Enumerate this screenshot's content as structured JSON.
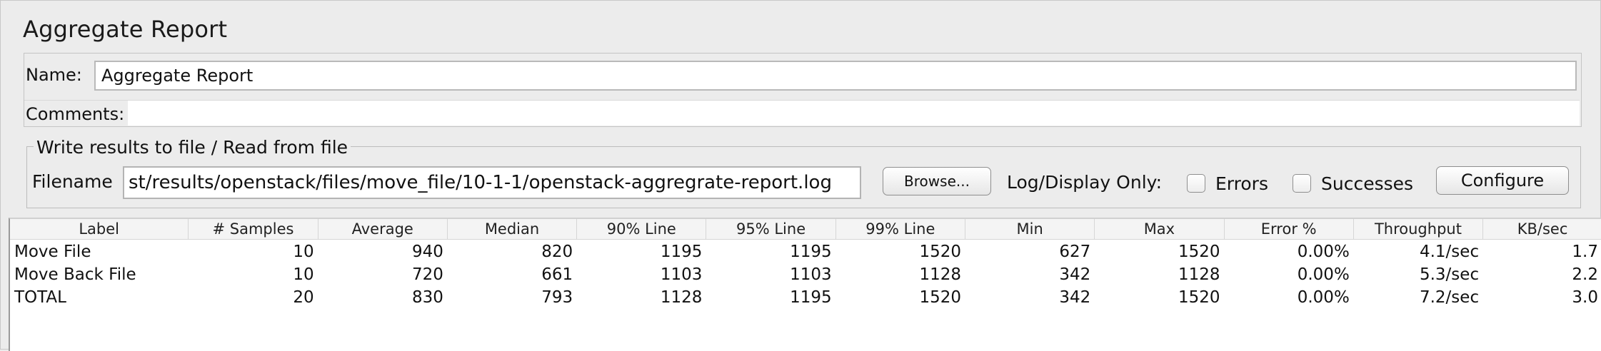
{
  "panel": {
    "title": "Aggregate Report",
    "name_label": "Name:",
    "name_value": "Aggregate Report",
    "comments_label": "Comments:",
    "comments_value": ""
  },
  "file_section": {
    "legend": "Write results to file / Read from file",
    "filename_label": "Filename",
    "filename_value": "st/results/openstack/files/move_file/10-1-1/openstack-aggregrate-report.log",
    "browse_label": "Browse...",
    "log_display_label": "Log/Display Only:",
    "errors_label": "Errors",
    "errors_checked": false,
    "successes_label": "Successes",
    "successes_checked": false,
    "configure_label": "Configure"
  },
  "table": {
    "columns": [
      "Label",
      "# Samples",
      "Average",
      "Median",
      "90% Line",
      "95% Line",
      "99% Line",
      "Min",
      "Max",
      "Error %",
      "Throughput",
      "KB/sec"
    ],
    "rows": [
      [
        "Move File",
        "10",
        "940",
        "820",
        "1195",
        "1195",
        "1520",
        "627",
        "1520",
        "0.00%",
        "4.1/sec",
        "1.7"
      ],
      [
        "Move Back File",
        "10",
        "720",
        "661",
        "1103",
        "1103",
        "1128",
        "342",
        "1128",
        "0.00%",
        "5.3/sec",
        "2.2"
      ],
      [
        "TOTAL",
        "20",
        "830",
        "793",
        "1128",
        "1195",
        "1520",
        "342",
        "1520",
        "0.00%",
        "7.2/sec",
        "3.0"
      ]
    ]
  }
}
